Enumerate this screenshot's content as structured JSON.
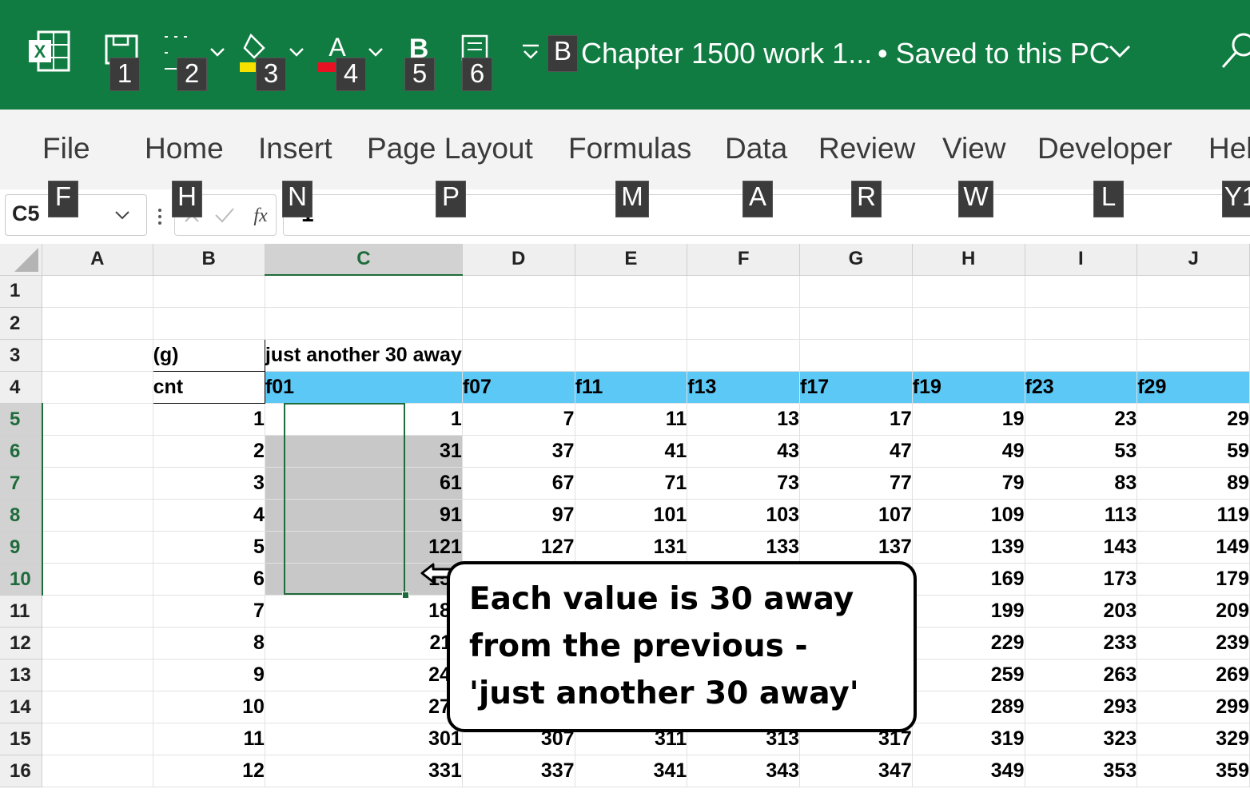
{
  "titlebar": {
    "doc_title": "Chapter 1500 work 1...",
    "saved_status": "• Saved to this PC",
    "keytips": [
      "1",
      "2",
      "3",
      "4",
      "5",
      "6",
      "B"
    ]
  },
  "ribbon": {
    "tabs": [
      {
        "label": "File",
        "keytip": "F"
      },
      {
        "label": "Home",
        "keytip": "H"
      },
      {
        "label": "Insert",
        "keytip": "N"
      },
      {
        "label": "Page Layout",
        "keytip": "P"
      },
      {
        "label": "Formulas",
        "keytip": "M"
      },
      {
        "label": "Data",
        "keytip": "A"
      },
      {
        "label": "Review",
        "keytip": "R"
      },
      {
        "label": "View",
        "keytip": "W"
      },
      {
        "label": "Developer",
        "keytip": "L"
      },
      {
        "label": "Hel",
        "keytip": "Y1"
      }
    ]
  },
  "formula_bar": {
    "name_box": "C5",
    "formula_value": "1"
  },
  "sheet": {
    "columns": [
      "A",
      "B",
      "C",
      "D",
      "E",
      "F",
      "G",
      "H",
      "I",
      "J"
    ],
    "selected_column": "C",
    "selected_rows": [
      "5",
      "6",
      "7",
      "8",
      "9",
      "10"
    ],
    "row3": {
      "b": "(g)",
      "c": "just another 30 away"
    },
    "row4": {
      "b": "cnt",
      "headers": [
        "f01",
        "f07",
        "f11",
        "f13",
        "f17",
        "f19",
        "f23",
        "f29"
      ]
    },
    "rows": [
      {
        "n": "1",
        "cnt": "",
        "vals": [
          "",
          "",
          "",
          "",
          "",
          "",
          "",
          ""
        ]
      },
      {
        "n": "2",
        "cnt": "",
        "vals": [
          "",
          "",
          "",
          "",
          "",
          "",
          "",
          ""
        ]
      },
      {
        "n": "5",
        "cnt": "1",
        "vals": [
          "1",
          "7",
          "11",
          "13",
          "17",
          "19",
          "23",
          "29"
        ]
      },
      {
        "n": "6",
        "cnt": "2",
        "vals": [
          "31",
          "37",
          "41",
          "43",
          "47",
          "49",
          "53",
          "59"
        ]
      },
      {
        "n": "7",
        "cnt": "3",
        "vals": [
          "61",
          "67",
          "71",
          "73",
          "77",
          "79",
          "83",
          "89"
        ]
      },
      {
        "n": "8",
        "cnt": "4",
        "vals": [
          "91",
          "97",
          "101",
          "103",
          "107",
          "109",
          "113",
          "119"
        ]
      },
      {
        "n": "9",
        "cnt": "5",
        "vals": [
          "121",
          "127",
          "131",
          "133",
          "137",
          "139",
          "143",
          "149"
        ]
      },
      {
        "n": "10",
        "cnt": "6",
        "vals": [
          "151",
          "",
          "",
          "",
          "",
          "169",
          "173",
          "179"
        ]
      },
      {
        "n": "11",
        "cnt": "7",
        "vals": [
          "181",
          "",
          "",
          "",
          "",
          "199",
          "203",
          "209"
        ]
      },
      {
        "n": "12",
        "cnt": "8",
        "vals": [
          "211",
          "",
          "",
          "",
          "",
          "229",
          "233",
          "239"
        ]
      },
      {
        "n": "13",
        "cnt": "9",
        "vals": [
          "241",
          "",
          "",
          "",
          "",
          "259",
          "263",
          "269"
        ]
      },
      {
        "n": "14",
        "cnt": "10",
        "vals": [
          "271",
          "",
          "",
          "",
          "",
          "289",
          "293",
          "299"
        ]
      },
      {
        "n": "15",
        "cnt": "11",
        "vals": [
          "301",
          "307",
          "311",
          "313",
          "317",
          "319",
          "323",
          "329"
        ]
      },
      {
        "n": "16",
        "cnt": "12",
        "vals": [
          "331",
          "337",
          "341",
          "343",
          "347",
          "349",
          "353",
          "359"
        ]
      }
    ]
  },
  "callout": {
    "lines": [
      "Each value is 30 away",
      "from the previous -",
      "'just another 30 away'"
    ]
  }
}
